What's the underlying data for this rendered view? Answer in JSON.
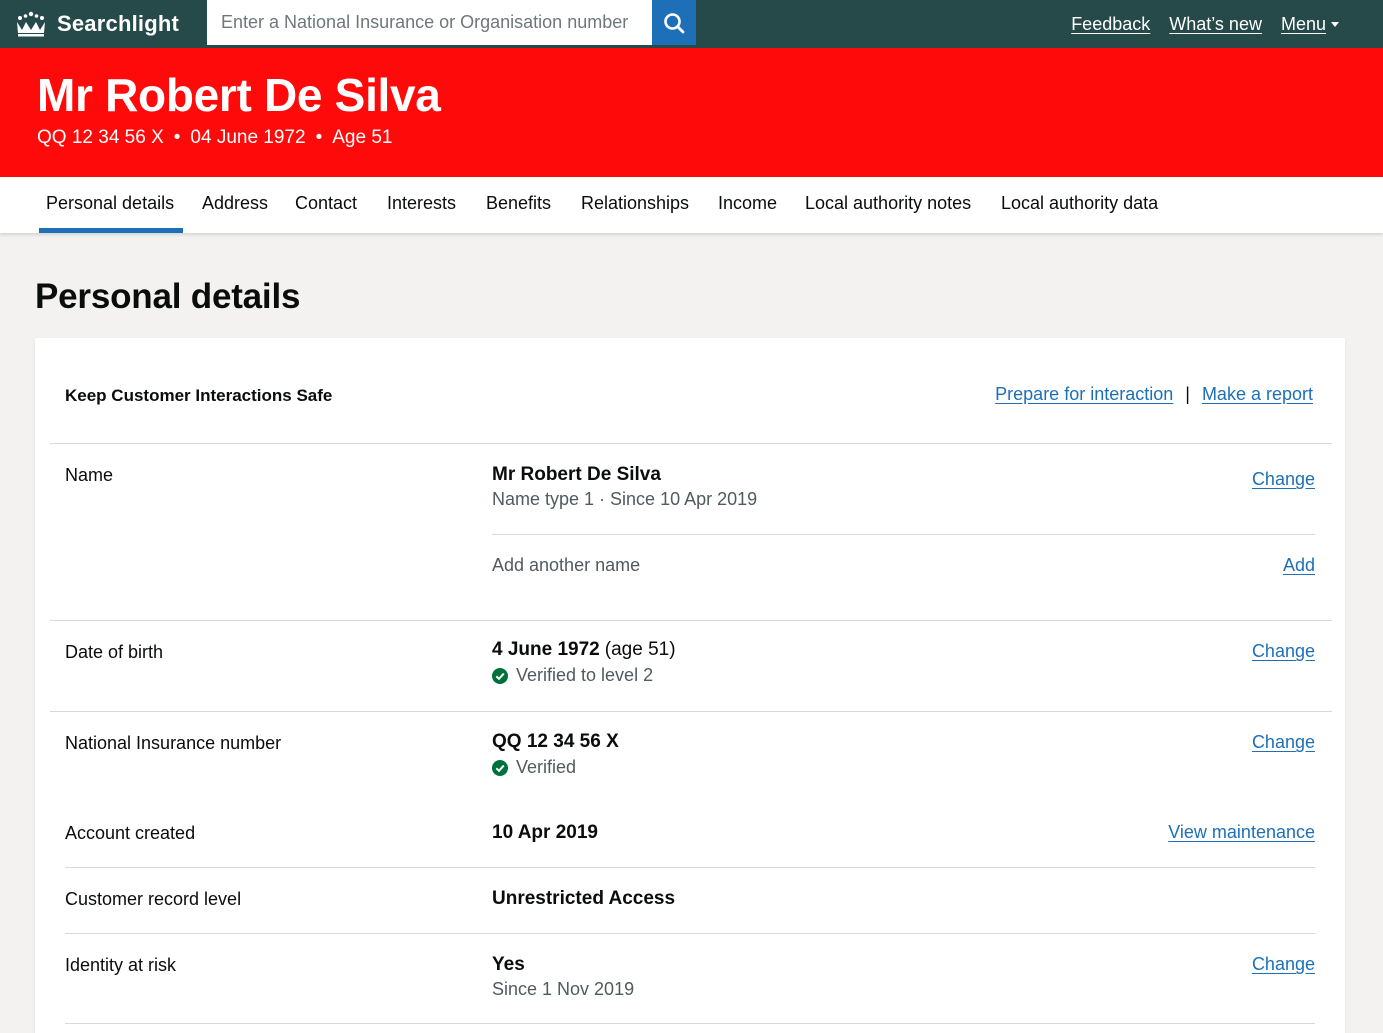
{
  "topbar": {
    "brand": "Searchlight",
    "search_placeholder": "Enter a National Insurance or Organisation number",
    "links": {
      "feedback": "Feedback",
      "whats_new": "What’s new",
      "menu": "Menu"
    }
  },
  "banner": {
    "name": "Mr Robert De Silva",
    "nino": "QQ 12 34 56 X",
    "dob": "04 June 1972",
    "age": "Age 51",
    "separator": "•"
  },
  "tabs": [
    {
      "label": "Personal details",
      "active": true
    },
    {
      "label": "Address"
    },
    {
      "label": "Contact"
    },
    {
      "label": "Interests"
    },
    {
      "label": "Benefits"
    },
    {
      "label": "Relationships"
    },
    {
      "label": "Income"
    },
    {
      "label": "Local authority notes"
    },
    {
      "label": "Local authority data"
    }
  ],
  "page_title": "Personal details",
  "kcis": {
    "title": "Keep Customer Interactions Safe",
    "prepare": "Prepare for interaction",
    "separator": "|",
    "report": "Make a report"
  },
  "rows": {
    "name": {
      "label": "Name",
      "value": "Mr Robert De Silva",
      "detail": "Name type 1 · Since 10 Apr 2019",
      "action": "Change",
      "add_text": "Add another name",
      "add_action": "Add"
    },
    "dob": {
      "label": "Date of birth",
      "value": "4 June 1972",
      "age": "(age 51)",
      "verified": "Verified to level 2",
      "action": "Change"
    },
    "nino": {
      "label": "National Insurance number",
      "value": "QQ 12 34 56 X",
      "verified": "Verified",
      "action": "Change"
    },
    "created": {
      "label": "Account created",
      "value": "10 Apr 2019",
      "action": "View maintenance"
    },
    "level": {
      "label": "Customer record level",
      "value": "Unrestricted Access"
    },
    "risk": {
      "label": "Identity at risk",
      "value": "Yes",
      "detail": "Since 1 Nov 2019",
      "action": "Change"
    }
  },
  "colors": {
    "header": "#264a4a",
    "banner": "#ff0a0a",
    "link": "#1d70b8",
    "verified": "#00703c",
    "tab_active": "#1d70b8"
  }
}
